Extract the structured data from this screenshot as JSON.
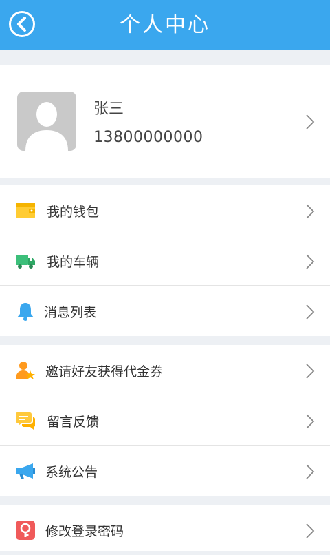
{
  "header": {
    "title": "个人中心"
  },
  "profile": {
    "name": "张三",
    "phone": "13800000000"
  },
  "menu": {
    "wallet": "我的钱包",
    "vehicles": "我的车辆",
    "messages": "消息列表",
    "invite": "邀请好友获得代金券",
    "feedback": "留言反馈",
    "announcements": "系统公告",
    "change_password": "修改登录密码"
  },
  "colors": {
    "header": "#3aa7ee",
    "wallet": "#ffcc33",
    "vehicle": "#3cbf7a",
    "bell": "#3aa7ee",
    "invite": "#ff9a1e",
    "feedback": "#ffc93c",
    "megaphone": "#3aa7ee",
    "password": "#f05a5a"
  }
}
